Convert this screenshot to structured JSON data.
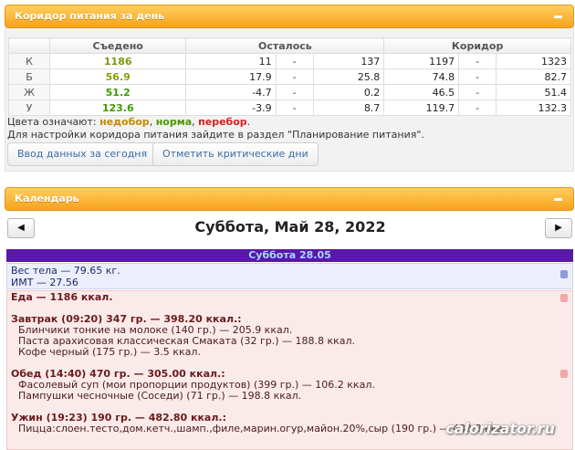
{
  "corridor_panel": {
    "title": "Коридор питания за день",
    "columns": [
      "Съедено",
      "Осталось",
      "Коридор"
    ],
    "rows": [
      {
        "label": "К",
        "eaten": "1186",
        "left_min": "11",
        "left_max": "137",
        "corr_min": "1197",
        "corr_max": "1323",
        "eaten_color": "#6b8e00"
      },
      {
        "label": "Б",
        "eaten": "56.9",
        "left_min": "17.9",
        "left_max": "25.8",
        "corr_min": "74.8",
        "corr_max": "82.7",
        "eaten_color": "#6b8e00"
      },
      {
        "label": "Ж",
        "eaten": "51.2",
        "left_min": "-4.7",
        "left_max": "0.2",
        "corr_min": "46.5",
        "corr_max": "51.4",
        "eaten_color": "#3f9a00"
      },
      {
        "label": "У",
        "eaten": "123.6",
        "left_min": "-3.9",
        "left_max": "8.7",
        "corr_min": "119.7",
        "corr_max": "132.3",
        "eaten_color": "#3f9a00"
      }
    ],
    "dash": "-",
    "legend_prefix": "Цвета означают:",
    "legend_under": "недобор",
    "legend_norm": "норма",
    "legend_over": "перебор",
    "hint": "Для настройки коридора питания зайдите в раздел \"Планирование питания\".",
    "btn_enter": "Ввод данных за сегодня",
    "btn_critical": "Отметить критические дни"
  },
  "calendar_panel": {
    "title": "Календарь",
    "prev_icon": "◀",
    "next_icon": "▶",
    "date_title": "Суббота, Май 28, 2022",
    "day_header": "Суббота 28.05",
    "weight_line": "Вес тела — 79.65 кг.",
    "bmi_line": "ИМТ — 27.56",
    "food_total": "Еда — 1186 ккал.",
    "breakfast": {
      "header": "Завтрак (09:20) 347 гр. — 398.20 ккал.:",
      "items": [
        "Блинчики тонкие на молоке (140 гр.) — 205.9 ккал.",
        "Паста арахисовая классическая Смаката (32 гр.) — 188.8 ккал.",
        "Кофе черный (175 гр.) — 3.5 ккал."
      ]
    },
    "lunch": {
      "header": "Обед (14:40) 470 гр. — 305.00 ккал.:",
      "items": [
        "Фасолевый суп (мои пропорции продуктов) (399 гр.) — 106.2 ккал.",
        "Пампушки чесночные (Соседи) (71 гр.) — 198.8 ккал."
      ]
    },
    "dinner": {
      "header": "Ужин (19:23) 190 гр. — 482.80 ккал.:",
      "items": [
        "Пицца:слоен.тесто,дом.кетч.,шамп.,филе,марин.огур,майон.20%,сыр (190 гр.) — 482.8 ккал."
      ]
    }
  },
  "watermark": "calorizator.ru"
}
